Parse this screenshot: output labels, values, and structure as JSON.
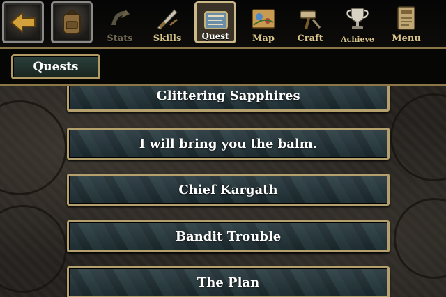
{
  "toolbar": {
    "tabs": {
      "stats": "Stats",
      "skills": "Skills",
      "quest": "Quest",
      "map": "Map",
      "craft": "Craft",
      "achieve": "Achieve",
      "menu": "Menu"
    }
  },
  "header": {
    "title": "Quests"
  },
  "quests": [
    {
      "title": "Glittering Sapphires"
    },
    {
      "title": "I will bring you the balm."
    },
    {
      "title": "Chief Kargath"
    },
    {
      "title": "Bandit Trouble"
    },
    {
      "title": "The Plan"
    }
  ],
  "colors": {
    "gold_border": "#b3a06d",
    "tab_label": "#d8c58a",
    "quest_bg": "#23343a"
  },
  "icons": [
    "back-arrow-icon",
    "backpack-icon",
    "stats-icon",
    "skills-icon",
    "quest-scroll-icon",
    "map-icon",
    "craft-icon",
    "trophy-icon",
    "menu-book-icon"
  ]
}
